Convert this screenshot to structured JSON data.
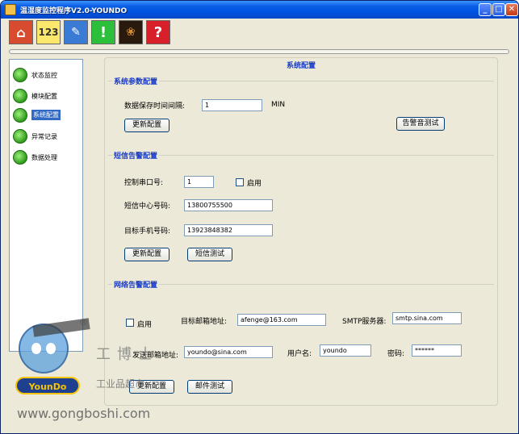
{
  "window": {
    "title": "温湿度监控程序V2.0-YOUNDO",
    "controls": {
      "minimize": "_",
      "maximize": "□",
      "close": "✕"
    }
  },
  "toolbar": {
    "items": [
      {
        "icon": "home-icon",
        "glyph": "⌂"
      },
      {
        "icon": "numbers-icon",
        "glyph": "123"
      },
      {
        "icon": "pencil-icon",
        "glyph": "✎"
      },
      {
        "icon": "exclamation-icon",
        "glyph": "!"
      },
      {
        "icon": "paw-icon",
        "glyph": "❀"
      },
      {
        "icon": "help-icon",
        "glyph": "?"
      }
    ]
  },
  "sidebar": {
    "items": [
      {
        "label": "状态监控",
        "active": false
      },
      {
        "label": "模块配置",
        "active": false
      },
      {
        "label": "系统配置",
        "active": true
      },
      {
        "label": "异常记录",
        "active": false
      },
      {
        "label": "数据处理",
        "active": false
      }
    ]
  },
  "main": {
    "title": "系统配置",
    "system": {
      "title": "系统参数配置",
      "interval_label": "数据保存时间间隔:",
      "interval_value": "1",
      "interval_unit": "MIN",
      "update_button": "更新配置",
      "alarm_test_button": "告警音测试"
    },
    "sms": {
      "title": "短信告警配置",
      "port_label": "控制串口号:",
      "port_value": "1",
      "enable_label": "启用",
      "enabled": false,
      "center_label": "短信中心号码:",
      "center_value": "13800755500",
      "target_label": "目标手机号码:",
      "target_value": "13923848382",
      "update_button": "更新配置",
      "test_button": "短信测试"
    },
    "net": {
      "title": "网络告警配置",
      "enable_label": "启用",
      "enabled": false,
      "target_email_label": "目标邮箱地址:",
      "target_email_value": "afenge@163.com",
      "smtp_label": "SMTP服务器:",
      "smtp_value": "smtp.sina.com",
      "sender_label": "发送邮箱地址:",
      "sender_value": "youndo@sina.com",
      "user_label": "用户名:",
      "user_value": "youndo",
      "password_label": "密码:",
      "password_value": "******",
      "update_button": "更新配置",
      "test_button": "邮件测试"
    }
  },
  "watermark": {
    "registered": "®",
    "name_cn": "工博士",
    "tagline": "工业品超市",
    "logo_text": "YounDo",
    "url": "www.gongboshi.com"
  }
}
